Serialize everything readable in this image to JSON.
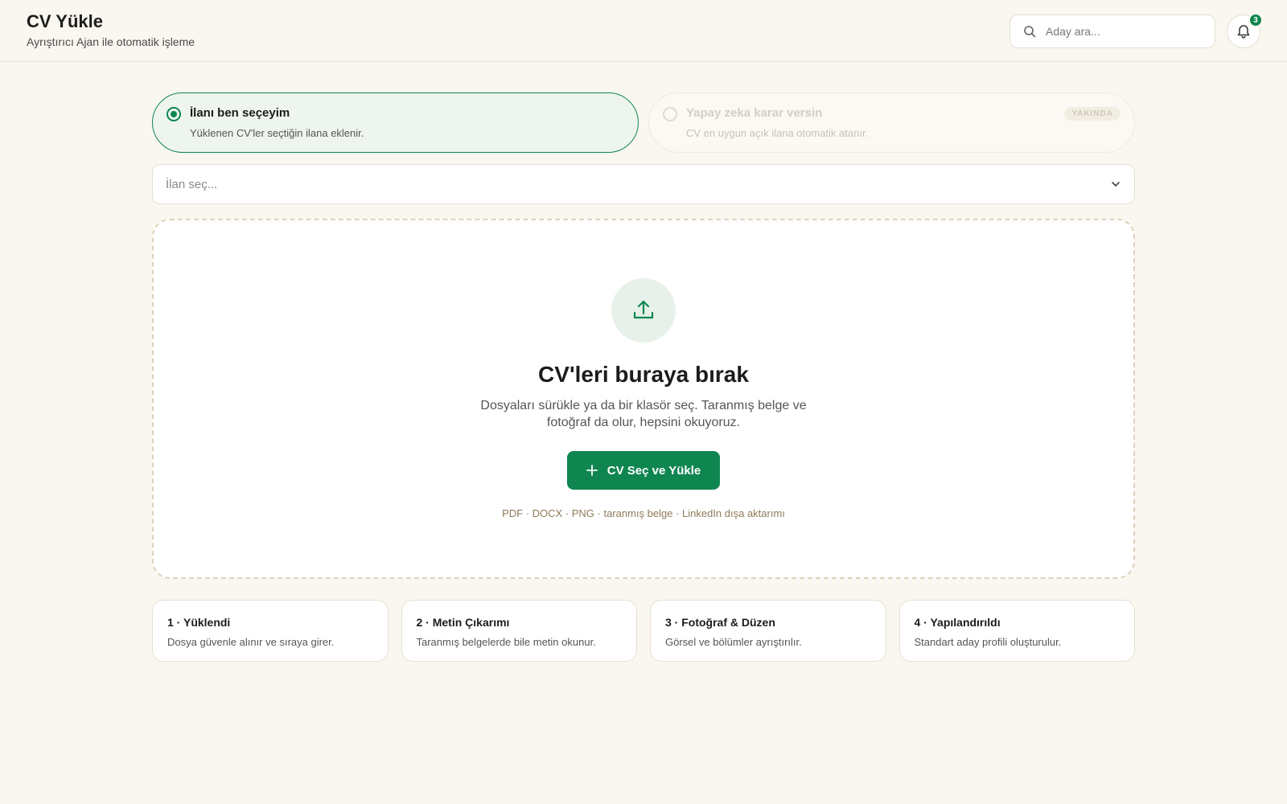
{
  "header": {
    "title": "CV Yükle",
    "subtitle": "Ayrıştırıcı Ajan ile otomatik işleme",
    "search_placeholder": "Aday ara...",
    "notification_count": "3"
  },
  "assignment": {
    "options": [
      {
        "title": "İlanı ben seçeyim",
        "description": "Yüklenen CV'ler seçtiğin ilana eklenir.",
        "selected": true
      },
      {
        "title": "Yapay zeka karar versin",
        "description": "CV en uygun açık ilana otomatik atanır.",
        "selected": false,
        "badge": "YAKINDA"
      }
    ]
  },
  "job_select": {
    "placeholder": "İlan seç..."
  },
  "dropzone": {
    "title": "CV'leri buraya bırak",
    "description": "Dosyaları sürükle ya da bir klasör seç. Taranmış belge ve fotoğraf da olur, hepsini okuyoruz.",
    "button_label": "CV Seç ve Yükle",
    "formats": "PDF · DOCX · PNG · taranmış belge · LinkedIn dışa aktarımı"
  },
  "steps": [
    {
      "title": "1 · Yüklendi",
      "description": "Dosya güvenle alınır ve sıraya girer."
    },
    {
      "title": "2 · Metin Çıkarımı",
      "description": "Taranmış belgelerde bile metin okunur."
    },
    {
      "title": "3 · Fotoğraf & Düzen",
      "description": "Görsel ve bölümler ayrıştırılır."
    },
    {
      "title": "4 · Yapılandırıldı",
      "description": "Standart aday profili oluşturulur."
    }
  ],
  "colors": {
    "accent": "#0f8650",
    "background": "#faf7f0"
  },
  "icons": {
    "search": "search-icon",
    "bell": "bell-icon",
    "chevron": "chevron-down-icon",
    "upload": "upload-icon",
    "plus": "plus-icon"
  }
}
